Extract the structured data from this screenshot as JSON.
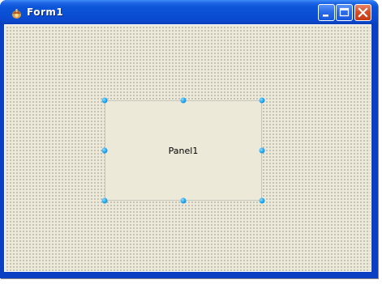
{
  "window": {
    "title": "Form1",
    "icon": "delphi-form-icon"
  },
  "caption_buttons": {
    "minimize_icon": "minimize-icon",
    "maximize_icon": "maximize-icon",
    "close_icon": "close-icon"
  },
  "panel": {
    "caption": "Panel1",
    "selected": true
  },
  "colors": {
    "titlebar_blue": "#0a4fd4",
    "client_face": "#ece9d8",
    "selection_handle": "#19a3ee",
    "close_red": "#d64f28"
  }
}
